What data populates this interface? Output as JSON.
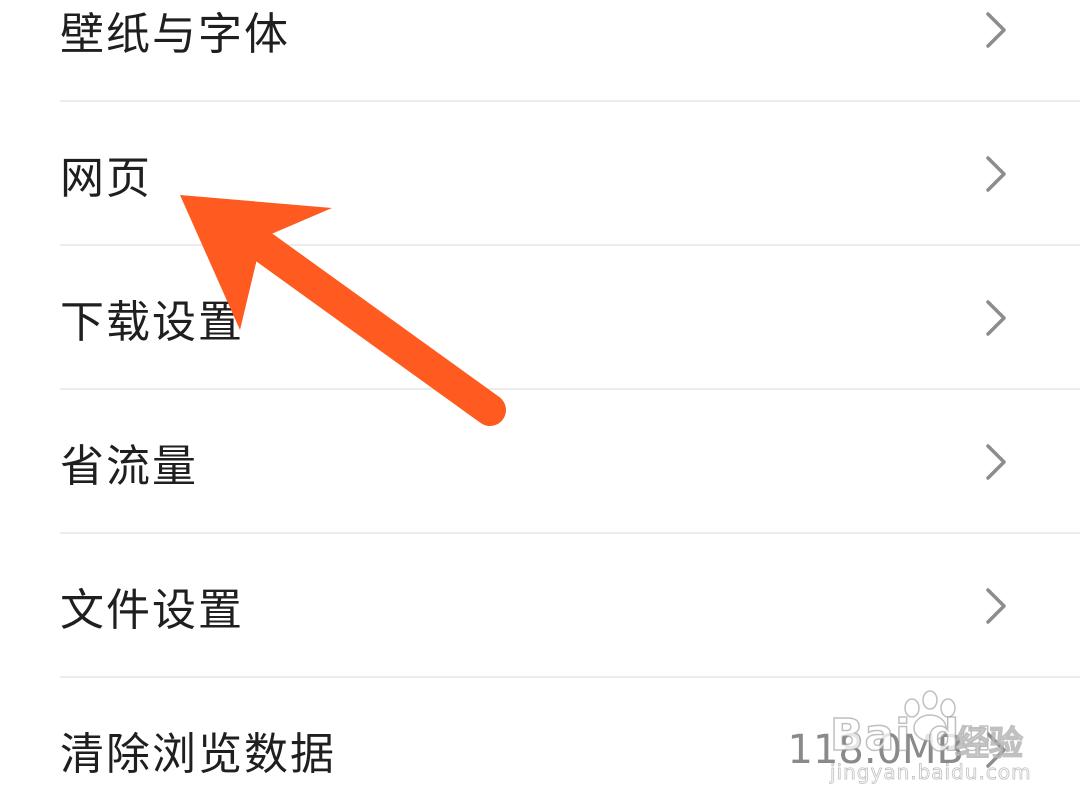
{
  "settings": {
    "items": [
      {
        "label": "壁纸与字体",
        "value": ""
      },
      {
        "label": "网页",
        "value": ""
      },
      {
        "label": "下载设置",
        "value": ""
      },
      {
        "label": "省流量",
        "value": ""
      },
      {
        "label": "文件设置",
        "value": ""
      },
      {
        "label": "清除浏览数据",
        "value": "118.0MB"
      }
    ]
  },
  "annotation": {
    "arrow_color": "#ff5a1f",
    "points_to": "网页"
  },
  "watermark": {
    "brand": "Bai du",
    "cn": "经验",
    "url": "jingyan.baidu.com"
  },
  "icons": {
    "chevron": "chevron-right-icon",
    "watermark_logo": "baidu-paw-icon"
  }
}
